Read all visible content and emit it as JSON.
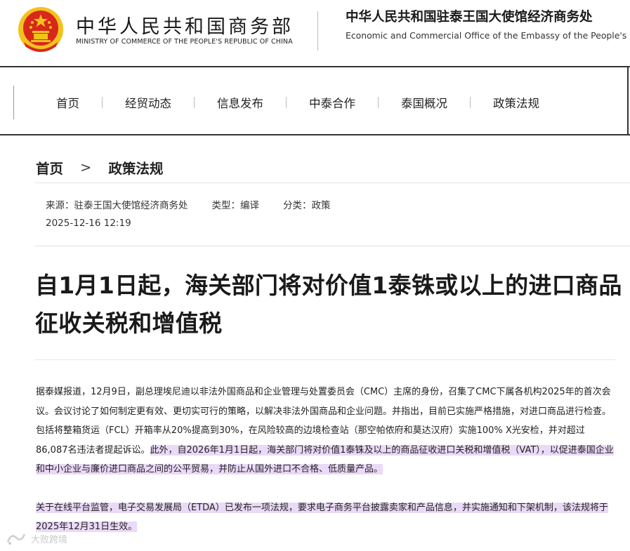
{
  "header": {
    "ministry_cn": "中华人民共和国商务部",
    "ministry_en": "MINISTRY OF COMMERCE OF THE PEOPLE'S REPUBLIC OF CHINA",
    "office_cn": "中华人民共和国驻泰王国大使馆经济商务处",
    "office_en": "Economic and Commercial Office of the Embassy of the People's Repu"
  },
  "nav": {
    "items": [
      "首页",
      "经贸动态",
      "信息发布",
      "中泰合作",
      "泰国概况",
      "政策法规"
    ]
  },
  "breadcrumb": {
    "home": "首页",
    "separator": ">",
    "current": "政策法规"
  },
  "meta": {
    "source": "来源：驻泰王国大使馆经济商务处",
    "type": "类型：编译",
    "category": "分类：政策",
    "date": "2025-12-16 12:19"
  },
  "article": {
    "title": "自1月1日起，海关部门将对价值1泰铢或以上的进口商品征收关税和增值税",
    "p1_text": "据泰媒报道，12月9日，副总理埃尼迪以非法外国商品和企业管理与处置委员会（CMC）主席的身份，召集了CMC下属各机构2025年的首次会议。会议讨论了如何制定更有效、更切实可行的策略，以解决非法外国商品和企业问题。并指出，目前已实施严格措施，对进口商品进行检查。包括将整箱货运（FCL）开箱率从20%提高到30%，在风险较高的边境检查站（那空帕侬府和莫达汉府）实施100% X光安检，并对超过86,087名违法者提起诉讼。",
    "p1_highlight": "此外，自2026年1月1日起，海关部门将对价值1泰铢及以上的商品征收进口关税和增值税（VAT），以促进泰国企业和中小企业与廉价进口商品之间的公平贸易，并防止从国外进口不合格、低质量产品。",
    "p2_highlight": "关于在线平台监管，电子交易发展局（ETDA）已发布一项法规，要求电子商务平台披露卖家和产品信息，并实施通知和下架机制，该法规将于2025年12月31日生效。"
  },
  "watermark": "大败跨境",
  "colors": {
    "highlight": "#ead9f7",
    "emblem_red": "#d8281c",
    "emblem_gold": "#f3c21b"
  }
}
